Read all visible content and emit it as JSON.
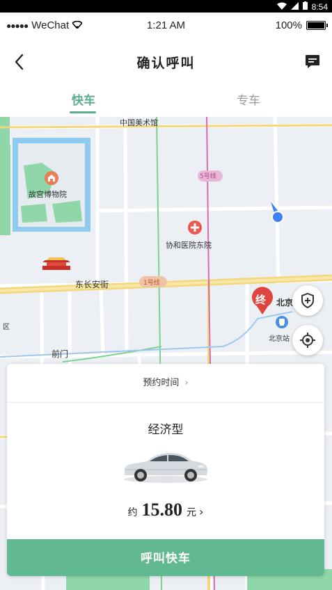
{
  "android_status": {
    "time": "8:54"
  },
  "ios_status": {
    "carrier": "WeChat",
    "time": "1:21 AM",
    "battery": "100%"
  },
  "navbar": {
    "title": "确认呼叫",
    "back_icon": "chevron-left-icon",
    "message_icon": "message-icon"
  },
  "tabs": [
    {
      "label": "快车",
      "active": true
    },
    {
      "label": "专车",
      "active": false
    }
  ],
  "map": {
    "labels": {
      "museum_top": "中国美术馆",
      "palace": "故宫博物院",
      "hospital": "协和医院东院",
      "road_main": "东长安街",
      "line1": "1号线",
      "line5": "5号线",
      "qianmen": "前门",
      "district": "区",
      "end_marker": "终",
      "end_text": "北京",
      "station": "北京站"
    },
    "colors": {
      "accent": "#5aae8a",
      "metro_line_pink": "#d46bb8",
      "end_marker": "#e0443f",
      "location_dot": "#3b82f6"
    }
  },
  "fab": {
    "safety_icon": "shield-plus-icon",
    "locate_icon": "crosshair-icon"
  },
  "order_card": {
    "booking_label": "预约时间",
    "car_type": "经济型",
    "price_prefix": "约",
    "price_value": "15.80",
    "price_unit": "元",
    "call_button": "呼叫快车"
  }
}
